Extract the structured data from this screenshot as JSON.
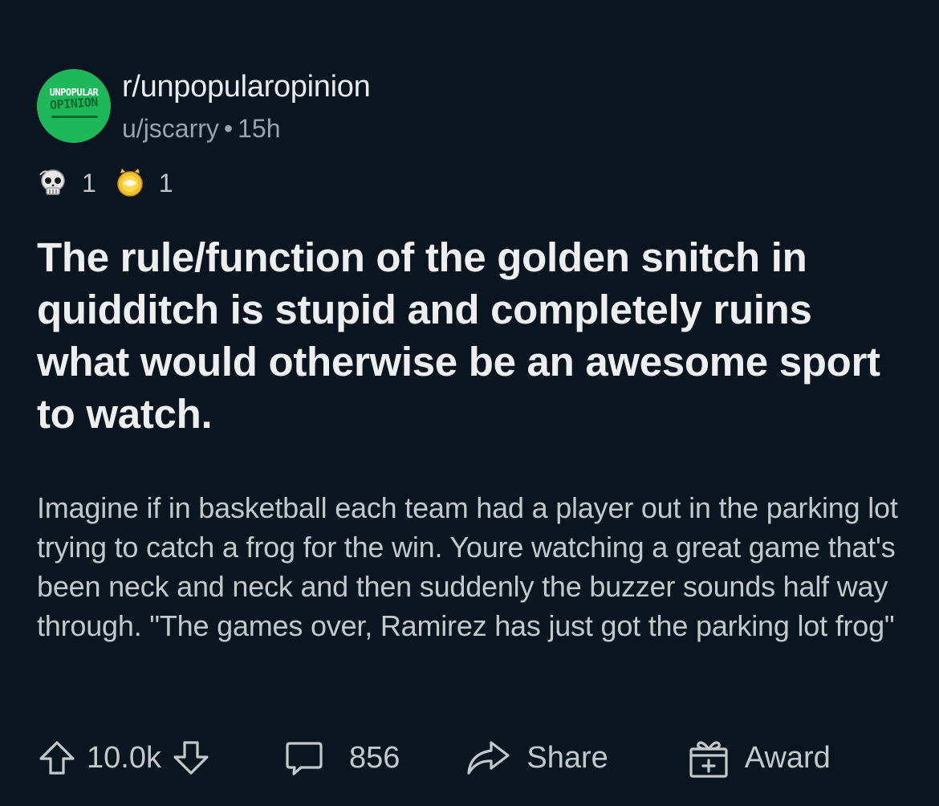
{
  "subreddit": {
    "name": "r/unpopularopinion",
    "logo_line1": "UNPOPULAR",
    "logo_line2": "OPINION",
    "brand_color": "#1eb85a"
  },
  "post": {
    "author": "u/jscarry",
    "separator": "•",
    "age": "15h",
    "awards": [
      {
        "icon": "skull-award-icon",
        "count": "1"
      },
      {
        "icon": "gold-award-icon",
        "count": "1"
      }
    ],
    "title": "The rule/function of the golden snitch in quidditch is stupid and completely ruins what would otherwise be an awesome sport to watch.",
    "body": "Imagine if in basketball each team had a player out in the parking lot trying to catch a frog for the win. Youre watching a great game that's been neck and neck and then suddenly the buzzer sounds half way through. \"The games over, Ramirez has just got the parking lot frog\""
  },
  "actions": {
    "score": "10.0k",
    "comments": "856",
    "share_label": "Share",
    "award_label": "Award"
  },
  "colors": {
    "background": "#0b1520",
    "title_text": "#eceef0",
    "body_text": "#c3c8cd",
    "meta_text": "#9aa3ab"
  }
}
